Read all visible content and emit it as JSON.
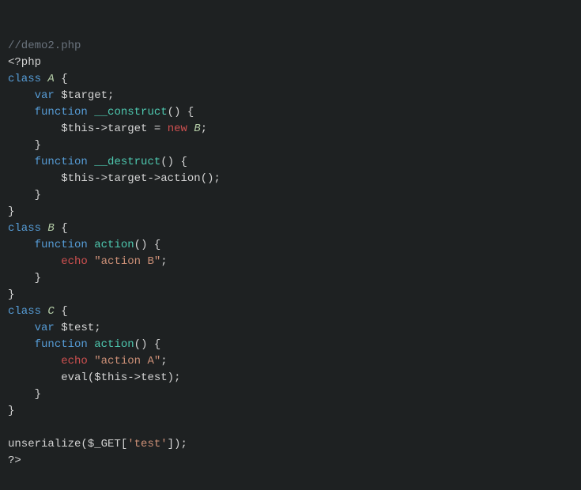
{
  "comment": "//demo2.php",
  "phpOpen": "<?php",
  "classKw": "class",
  "varKw": "var",
  "functionKw": "function",
  "newKw": "new",
  "echoKw": "echo",
  "classA": "A",
  "classB": "B",
  "classC": "C",
  "varTarget": "$target",
  "varTest": "$test",
  "varThis": "$this",
  "construct": "__construct",
  "destruct": "__destruct",
  "action": "action",
  "strActionB": "\"action B\"",
  "strActionA": "\"action A\"",
  "strTest": "'test'",
  "eval": "eval",
  "unserialize": "unserialize",
  "get": "$_GET",
  "phpClose": "?>",
  "lbrace": "{",
  "rbrace": "}",
  "lparen": "(",
  "rparen": ")",
  "lbracket": "[",
  "rbracket": "]",
  "semi": ";",
  "arrow": "->",
  "eq": "=",
  "target": "target",
  "test": "test",
  "chart_data": {
    "type": "table",
    "title": "PHP source: demo2.php",
    "code_lines": [
      "//demo2.php",
      "<?php",
      "class A {",
      "    var $target;",
      "    function __construct() {",
      "        $this->target = new B;",
      "    }",
      "    function __destruct() {",
      "        $this->target->action();",
      "    }",
      "}",
      "class B {",
      "    function action() {",
      "        echo \"action B\";",
      "    }",
      "}",
      "class C {",
      "    var $test;",
      "    function action() {",
      "        echo \"action A\";",
      "        eval($this->test);",
      "    }",
      "}",
      "",
      "unserialize($_GET['test']);",
      "?>"
    ]
  }
}
